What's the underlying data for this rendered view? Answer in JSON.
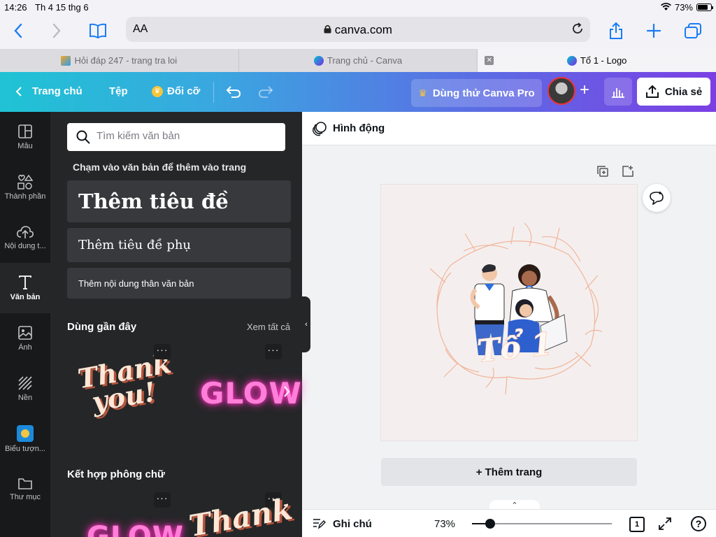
{
  "status": {
    "time": "14:26",
    "date": "Th 4 15 thg 6",
    "battery": "73%"
  },
  "browser": {
    "aa_label": "AA",
    "address": "canva.com",
    "tabs": [
      {
        "label": "Hỏi đáp 247 - trang tra loi"
      },
      {
        "label": "Trang chủ - Canva"
      },
      {
        "label": "Tổ 1 - Logo"
      }
    ]
  },
  "header": {
    "home": "Trang chủ",
    "file": "Tệp",
    "resize": "Đổi cỡ",
    "pro": "Dùng thử Canva Pro",
    "share": "Chia sẻ"
  },
  "rail": [
    {
      "label": "Mẫu"
    },
    {
      "label": "Thành phần"
    },
    {
      "label": "Nội dung t..."
    },
    {
      "label": "Văn bản"
    },
    {
      "label": "Ảnh"
    },
    {
      "label": "Nền"
    },
    {
      "label": "Biểu tượn..."
    },
    {
      "label": "Thư mục"
    }
  ],
  "panel": {
    "search_placeholder": "Tìm kiếm văn bản",
    "hint": "Chạm vào văn bản để thêm vào trang",
    "heading": "Thêm tiêu đề",
    "subheading": "Thêm tiêu đề phụ",
    "body": "Thêm nội dung thân văn bản",
    "recent_title": "Dùng gần đây",
    "see_all": "Xem tất cả",
    "combos_title": "Kết hợp phông chữ",
    "sample_thank_1": "Thank",
    "sample_thank_2": "you!",
    "sample_glow": "GLOW"
  },
  "editor": {
    "animate": "Hình động",
    "design_text": "Tổ 1",
    "add_page": "+ Thêm trang",
    "notes": "Ghi chú",
    "zoom": "73%",
    "zoom_fraction": 0.73,
    "page_count": "1",
    "help": "?"
  }
}
